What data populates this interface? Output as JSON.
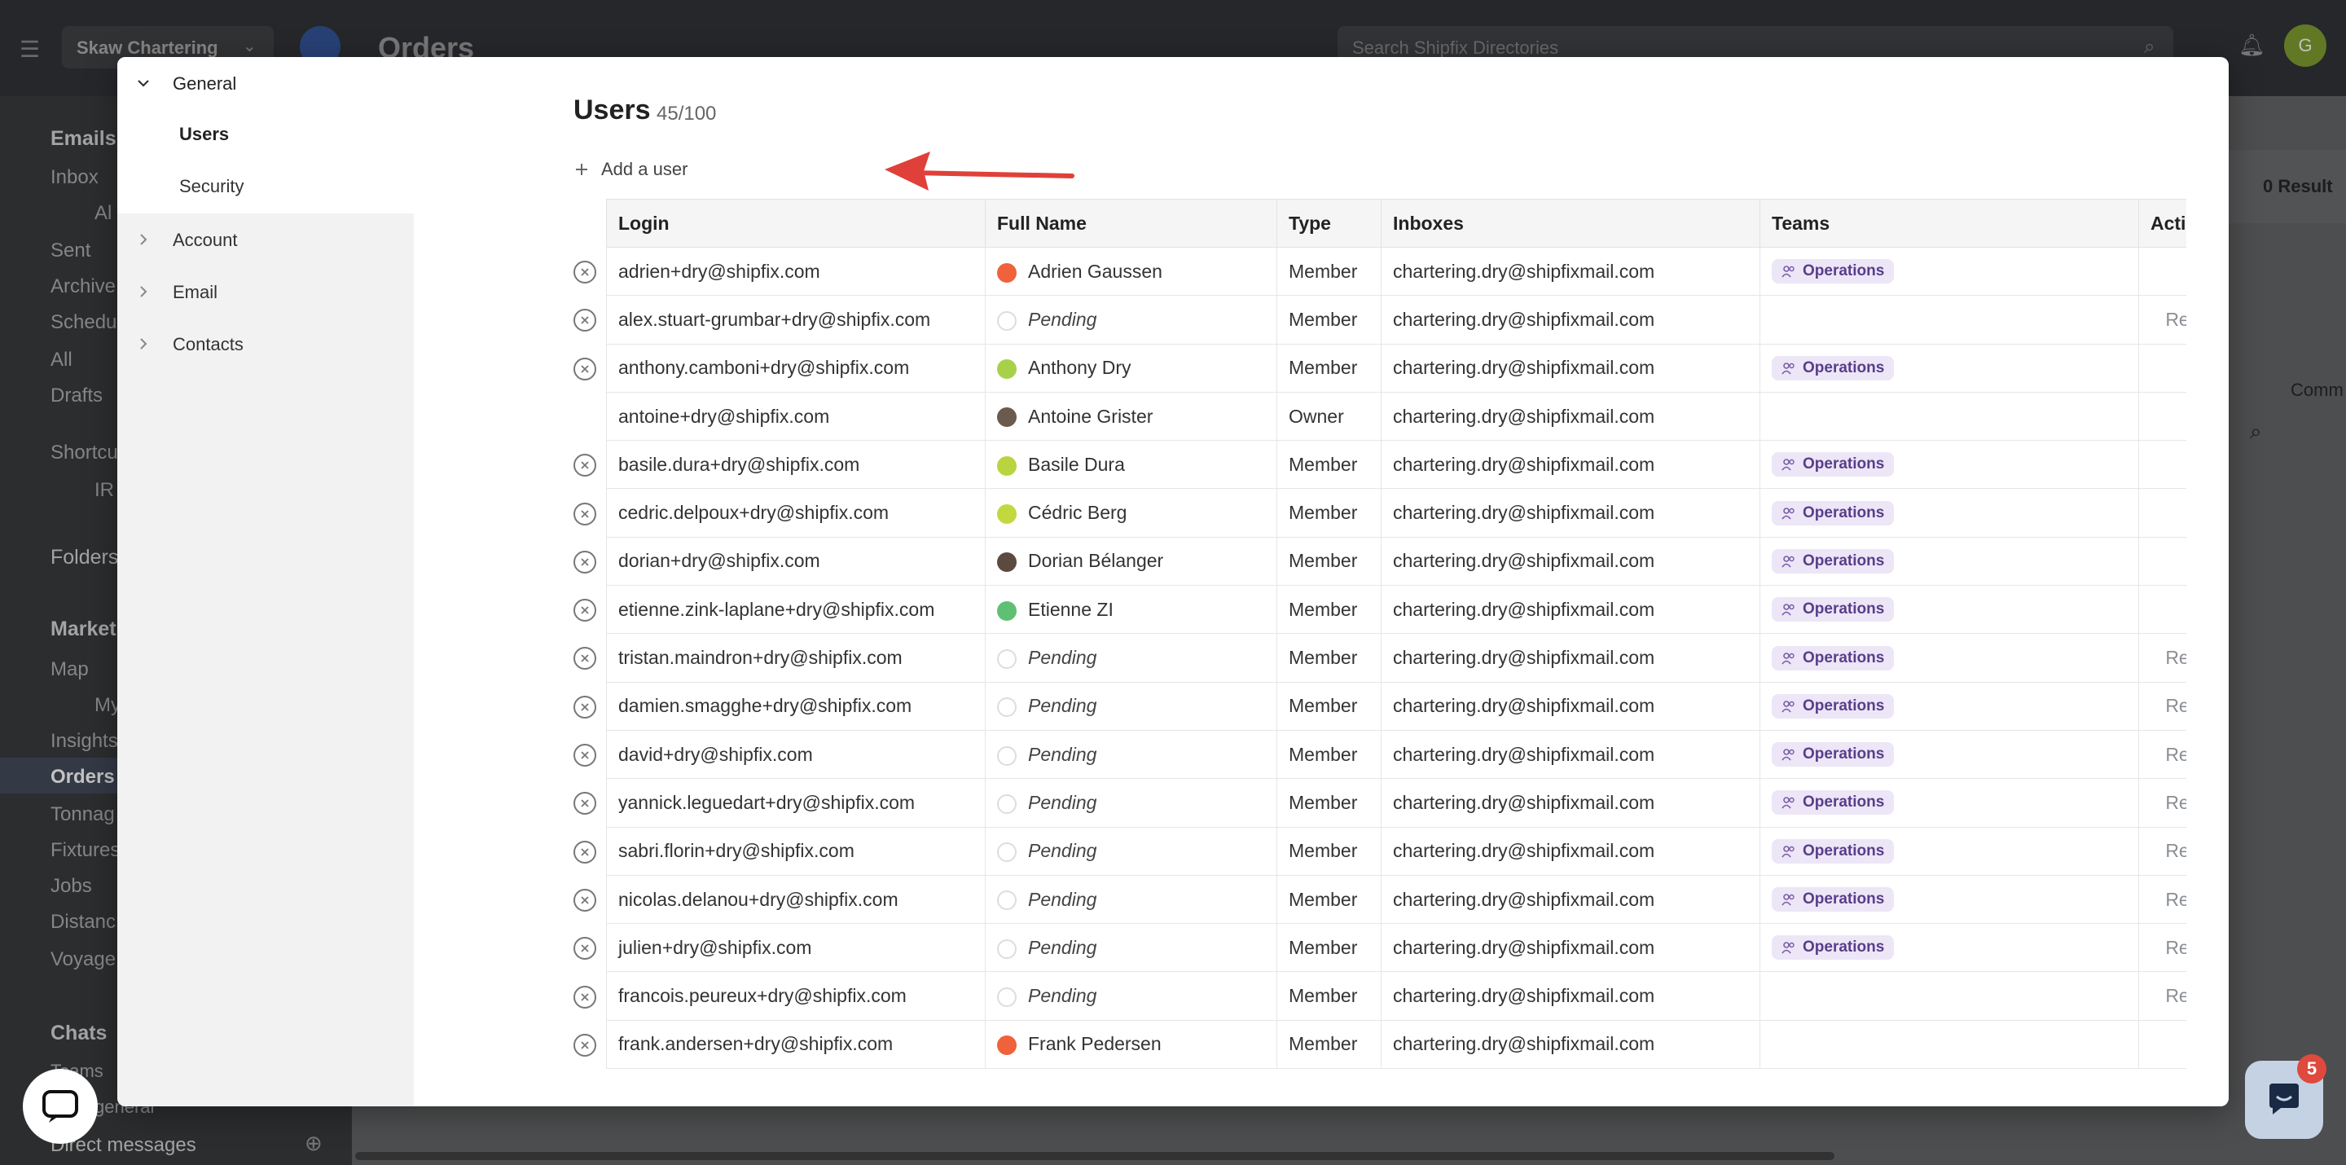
{
  "background": {
    "workspace": "Skaw Chartering",
    "page_title": "Orders",
    "search_placeholder": "Search Shipfix Directories",
    "avatar_initials": "G",
    "results": "0 Result",
    "column_partial": "Comm",
    "sidebar": {
      "emails_title": "Emails",
      "email_items": [
        "Inbox",
        "Al",
        "Sent",
        "Archive",
        "Schedu",
        "All",
        "Drafts",
        "Shortcu",
        "IR",
        "Folders"
      ],
      "market_title": "Market",
      "market_items": [
        "Map",
        "My",
        "Insights",
        "Orders",
        "Tonnag",
        "Fixtures",
        "Jobs",
        "Distanc",
        "Voyage"
      ],
      "chats_title": "Chats",
      "chat_items": [
        "Teams",
        "general",
        "Direct messages"
      ]
    }
  },
  "modal": {
    "nav": {
      "general": "General",
      "users": "Users",
      "security": "Security",
      "account": "Account",
      "email": "Email",
      "contacts": "Contacts"
    },
    "title": "Users",
    "count": "45/100",
    "add_user_label": "Add a user",
    "table": {
      "headers": [
        "Login",
        "Full Name",
        "Type",
        "Inboxes",
        "Teams",
        "Actions"
      ],
      "rows": [
        {
          "removable": true,
          "login": "adrien+dry@shipfix.com",
          "name": "Adrien Gaussen",
          "pending": false,
          "avatar_color": "#f0623b",
          "type": "Member",
          "inbox": "chartering.dry@shipfixmail.com",
          "team": "Operations",
          "action": ""
        },
        {
          "removable": true,
          "login": "alex.stuart-grumbar+dry@shipfix.com",
          "name": "Pending",
          "pending": true,
          "avatar_color": "",
          "type": "Member",
          "inbox": "chartering.dry@shipfixmail.com",
          "team": "",
          "action": "Resend invite"
        },
        {
          "removable": true,
          "login": "anthony.camboni+dry@shipfix.com",
          "name": "Anthony Dry",
          "pending": false,
          "avatar_color": "#a8d14a",
          "type": "Member",
          "inbox": "chartering.dry@shipfixmail.com",
          "team": "Operations",
          "action": ""
        },
        {
          "removable": false,
          "login": "antoine+dry@shipfix.com",
          "name": "Antoine Grister",
          "pending": false,
          "avatar_color": "#6b5a4e",
          "type": "Owner",
          "inbox": "chartering.dry@shipfixmail.com",
          "team": "",
          "action": ""
        },
        {
          "removable": true,
          "login": "basile.dura+dry@shipfix.com",
          "name": "Basile Dura",
          "pending": false,
          "avatar_color": "#b8d43e",
          "type": "Member",
          "inbox": "chartering.dry@shipfixmail.com",
          "team": "Operations",
          "action": ""
        },
        {
          "removable": true,
          "login": "cedric.delpoux+dry@shipfix.com",
          "name": "Cédric Berg",
          "pending": false,
          "avatar_color": "#c2d83e",
          "type": "Member",
          "inbox": "chartering.dry@shipfixmail.com",
          "team": "Operations",
          "action": ""
        },
        {
          "removable": true,
          "login": "dorian+dry@shipfix.com",
          "name": "Dorian Bélanger",
          "pending": false,
          "avatar_color": "#5c4a40",
          "type": "Member",
          "inbox": "chartering.dry@shipfixmail.com",
          "team": "Operations",
          "action": ""
        },
        {
          "removable": true,
          "login": "etienne.zink-laplane+dry@shipfix.com",
          "name": "Etienne ZI",
          "pending": false,
          "avatar_color": "#5fbf73",
          "type": "Member",
          "inbox": "chartering.dry@shipfixmail.com",
          "team": "Operations",
          "action": ""
        },
        {
          "removable": true,
          "login": "tristan.maindron+dry@shipfix.com",
          "name": "Pending",
          "pending": true,
          "avatar_color": "",
          "type": "Member",
          "inbox": "chartering.dry@shipfixmail.com",
          "team": "Operations",
          "action": "Resend invite"
        },
        {
          "removable": true,
          "login": "damien.smagghe+dry@shipfix.com",
          "name": "Pending",
          "pending": true,
          "avatar_color": "",
          "type": "Member",
          "inbox": "chartering.dry@shipfixmail.com",
          "team": "Operations",
          "action": "Resend invite"
        },
        {
          "removable": true,
          "login": "david+dry@shipfix.com",
          "name": "Pending",
          "pending": true,
          "avatar_color": "",
          "type": "Member",
          "inbox": "chartering.dry@shipfixmail.com",
          "team": "Operations",
          "action": "Resend invite"
        },
        {
          "removable": true,
          "login": "yannick.leguedart+dry@shipfix.com",
          "name": "Pending",
          "pending": true,
          "avatar_color": "",
          "type": "Member",
          "inbox": "chartering.dry@shipfixmail.com",
          "team": "Operations",
          "action": "Resend invite"
        },
        {
          "removable": true,
          "login": "sabri.florin+dry@shipfix.com",
          "name": "Pending",
          "pending": true,
          "avatar_color": "",
          "type": "Member",
          "inbox": "chartering.dry@shipfixmail.com",
          "team": "Operations",
          "action": "Resend invite"
        },
        {
          "removable": true,
          "login": "nicolas.delanou+dry@shipfix.com",
          "name": "Pending",
          "pending": true,
          "avatar_color": "",
          "type": "Member",
          "inbox": "chartering.dry@shipfixmail.com",
          "team": "Operations",
          "action": "Resend invite"
        },
        {
          "removable": true,
          "login": "julien+dry@shipfix.com",
          "name": "Pending",
          "pending": true,
          "avatar_color": "",
          "type": "Member",
          "inbox": "chartering.dry@shipfixmail.com",
          "team": "Operations",
          "action": "Resend invite"
        },
        {
          "removable": true,
          "login": "francois.peureux+dry@shipfix.com",
          "name": "Pending",
          "pending": true,
          "avatar_color": "",
          "type": "Member",
          "inbox": "chartering.dry@shipfixmail.com",
          "team": "",
          "action": "Resend invite"
        },
        {
          "removable": true,
          "login": "frank.andersen+dry@shipfix.com",
          "name": "Frank Pedersen",
          "pending": false,
          "avatar_color": "#f0623b",
          "type": "Member",
          "inbox": "chartering.dry@shipfixmail.com",
          "team": "",
          "action": ""
        }
      ]
    }
  },
  "chat_badge_count": "5",
  "colors": {
    "team_badge_bg": "#ece6f7",
    "team_badge_text": "#5a3d8a",
    "arrow": "#e0403a",
    "badge": "#e0493d"
  }
}
